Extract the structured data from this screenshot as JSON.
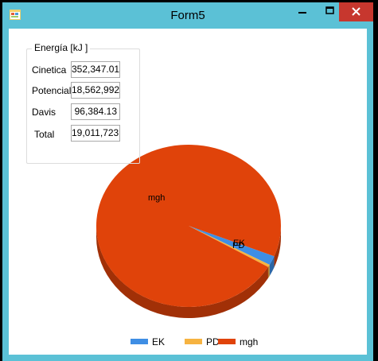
{
  "window": {
    "title": "Form5",
    "icons": {
      "app": "form-icon",
      "minimize": "minimize-icon",
      "maximize": "maximize-icon",
      "close": "close-icon"
    }
  },
  "energy_group": {
    "title": "Energía [kJ ]",
    "rows": [
      {
        "label": "Cinetica",
        "value": "352,347.01"
      },
      {
        "label": "Potencial",
        "value": "18,562,992"
      },
      {
        "label": "Davis",
        "value": "96,384.13"
      },
      {
        "label": "Total",
        "value": "19,011,723"
      }
    ]
  },
  "chart_data": {
    "type": "pie",
    "categories": [
      "EK",
      "PD",
      "mgh"
    ],
    "values": [
      352347.01,
      96384.13,
      18562992
    ],
    "colors": [
      "#3f8ee4",
      "#f6b341",
      "#e0430a"
    ],
    "slice_labels": [
      "EK",
      "PD",
      "mgh"
    ],
    "legend": [
      "EK",
      "PD",
      "mgh"
    ],
    "legend_position": "bottom"
  }
}
